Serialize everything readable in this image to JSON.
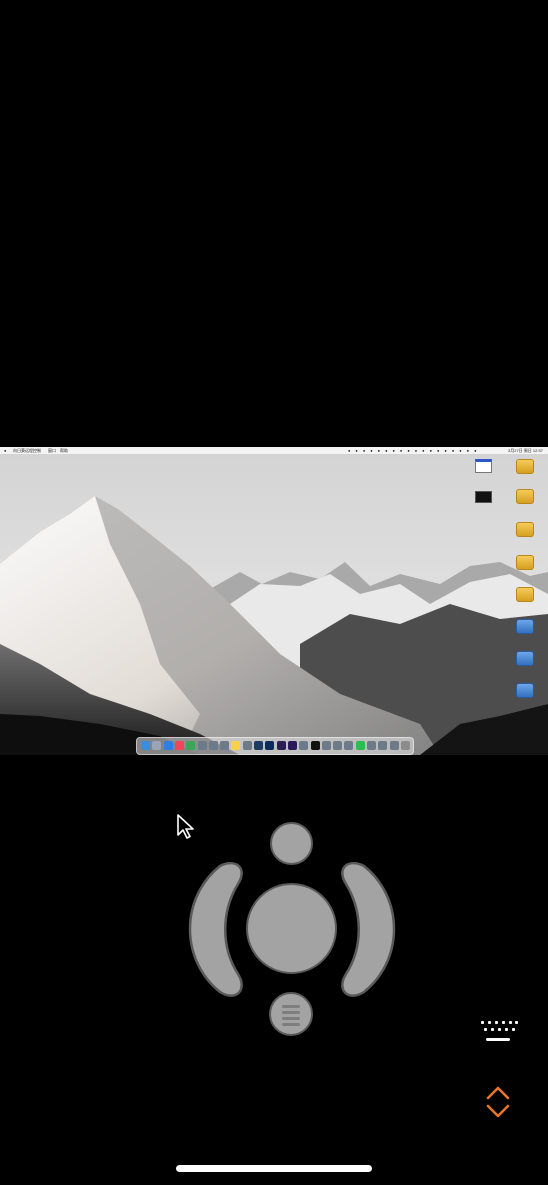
{
  "remote_desktop": {
    "menubar": {
      "app_menu_label": "向日葵远程控制",
      "menu_items": [
        "窗口",
        "帮助"
      ],
      "clock": "3月27日 周日 12:57"
    },
    "desktop_icons": [
      {
        "name": "display-icon",
        "label": ""
      },
      {
        "name": "display-icon",
        "label": ""
      },
      {
        "name": "drive-icon",
        "label": ""
      },
      {
        "name": "drive-icon",
        "label": ""
      },
      {
        "name": "drive-icon",
        "label": ""
      },
      {
        "name": "drive-icon",
        "label": ""
      },
      {
        "name": "drive-icon",
        "label": ""
      },
      {
        "name": "network-drive-icon",
        "label": ""
      },
      {
        "name": "network-drive-icon",
        "label": ""
      },
      {
        "name": "network-drive-icon",
        "label": ""
      }
    ],
    "dock_apps": [
      "finder",
      "launchpad",
      "safari",
      "music",
      "chrome",
      "app",
      "app",
      "app",
      "notes",
      "app",
      "lightroom-classic",
      "photoshop",
      "after-effects",
      "premiere-pro",
      "app",
      "capcut",
      "app",
      "app",
      "app",
      "wechat",
      "app",
      "app",
      "app",
      "trash"
    ]
  },
  "controller": {
    "top_button": "",
    "center_button": "",
    "left_button": "",
    "right_button": "",
    "scroll_button": ""
  },
  "icons": {
    "keyboard": "keyboard-icon",
    "expand": "chevron-up-down-icon",
    "pointer": "mouse-pointer-icon"
  },
  "colors": {
    "background": "#000000",
    "controller_fill": "#a3a3a3",
    "controller_border": "#5a5a5a",
    "accent_orange": "#e8732a"
  }
}
